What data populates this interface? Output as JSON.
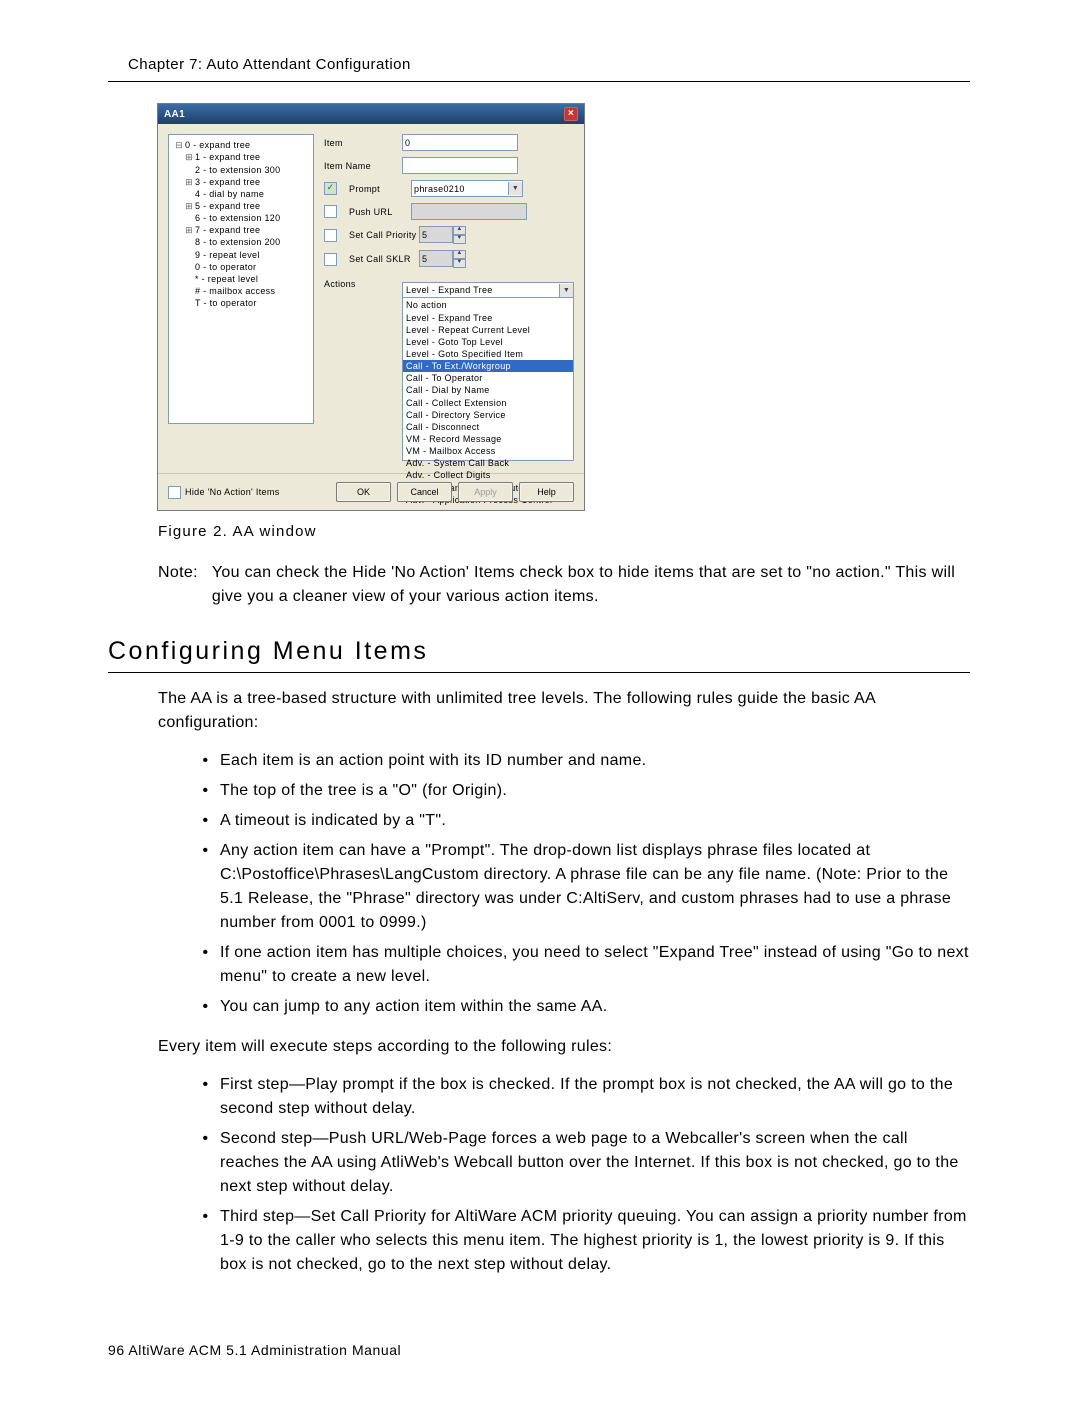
{
  "header": {
    "chapter": "Chapter 7:  Auto Attendant Configuration"
  },
  "dialog": {
    "title": "AA1",
    "close": "×",
    "tree": {
      "selected": "0 - expand tree",
      "items": [
        {
          "glyph": "-",
          "indent": 0,
          "text": "0 - expand tree",
          "sel": true
        },
        {
          "glyph": "+",
          "indent": 1,
          "text": "1 - expand tree"
        },
        {
          "glyph": "",
          "indent": 1,
          "text": "2 - to extension 300"
        },
        {
          "glyph": "+",
          "indent": 1,
          "text": "3 - expand tree"
        },
        {
          "glyph": "",
          "indent": 1,
          "text": "4 - dial by name"
        },
        {
          "glyph": "+",
          "indent": 1,
          "text": "5 - expand tree"
        },
        {
          "glyph": "",
          "indent": 1,
          "text": "6 - to extension 120"
        },
        {
          "glyph": "+",
          "indent": 1,
          "text": "7 - expand tree"
        },
        {
          "glyph": "",
          "indent": 1,
          "text": "8 - to extension 200"
        },
        {
          "glyph": "",
          "indent": 1,
          "text": "9 - repeat level"
        },
        {
          "glyph": "",
          "indent": 1,
          "text": "0 - to operator"
        },
        {
          "glyph": "",
          "indent": 1,
          "text": "* - repeat level"
        },
        {
          "glyph": "",
          "indent": 1,
          "text": "# - mailbox access"
        },
        {
          "glyph": "",
          "indent": 1,
          "text": "T - to operator"
        }
      ]
    },
    "form": {
      "item_label": "Item",
      "item_value": "0",
      "name_label": "Item Name",
      "name_value": "",
      "prompt_label": "Prompt",
      "prompt_value": "phrase0210",
      "prompt_checked": true,
      "push_url_label": "Push URL",
      "push_url_value": "",
      "cp_label": "Set Call Priority",
      "cp_value": "5",
      "sk_label": "Set Call SKLR",
      "sk_value": "5",
      "actions_label": "Actions",
      "actions_selected": "Level - Expand Tree",
      "actions": [
        "No action",
        "Level - Expand Tree",
        "Level - Repeat Current Level",
        "Level - Goto Top Level",
        "Level - Goto Specified Item",
        "Call - To Ext./Workgroup",
        "Call - To Operator",
        "Call - Dial by Name",
        "Call - Collect Extension",
        "Call - Directory Service",
        "Call - Disconnect",
        "VM - Record Message",
        "VM - Mailbox Access",
        "Adv. - System Call Back",
        "Adv. - Collect Digits",
        "Adv. - Advanced Call Router",
        "Adv. - Application Process Control"
      ],
      "actions_highlight_index": 5
    },
    "footer": {
      "hide_label": "Hide 'No Action' Items",
      "ok": "OK",
      "cancel": "Cancel",
      "apply": "Apply",
      "help": "Help"
    }
  },
  "caption": "Figure 2.    AA window",
  "note": {
    "tag": "Note:",
    "text": "You can check the Hide 'No Action' Items check box to hide items that are set to \"no action.\" This will give you a cleaner view of your various action items."
  },
  "section_title": "Configuring Menu Items",
  "intro": "The AA is a tree-based structure with unlimited tree levels. The following rules guide the basic AA configuration:",
  "bul1": [
    "Each item is an action point with its ID number and name.",
    "The top of the tree is a \"O\" (for Origin).",
    "A timeout is indicated by a \"T\".",
    "Any action item can have a \"Prompt\". The drop-down list displays phrase files located at C:\\Postoffice\\Phrases\\LangCustom directory. A phrase file can be any file name. (Note: Prior to the 5.1 Release, the \"Phrase\" directory was under C:AltiServ, and custom phrases had to use a phrase number from 0001 to 0999.)",
    "If one action item has multiple choices, you need to select \"Expand Tree\" instead of using \"Go to next menu\" to create a new level.",
    "You can jump to any action item within the same AA."
  ],
  "mid": "Every item will execute steps according to the following rules:",
  "bul2": [
    "First step—Play prompt if the box is checked. If the prompt box is not checked, the AA will go to the second step without delay.",
    "Second step—Push URL/Web-Page forces a web page to a Webcaller's screen when the call reaches the AA using AtliWeb's Webcall button over the Internet. If this box is not checked, go to the next step without delay.",
    "Third step—Set Call Priority for AltiWare ACM priority queuing. You can assign a priority number from 1-9 to the caller who selects this menu item. The highest priority is 1, the lowest priority is 9. If this box is not checked, go to the next step without delay."
  ],
  "footer_text": "96   AltiWare ACM 5.1 Administration Manual"
}
